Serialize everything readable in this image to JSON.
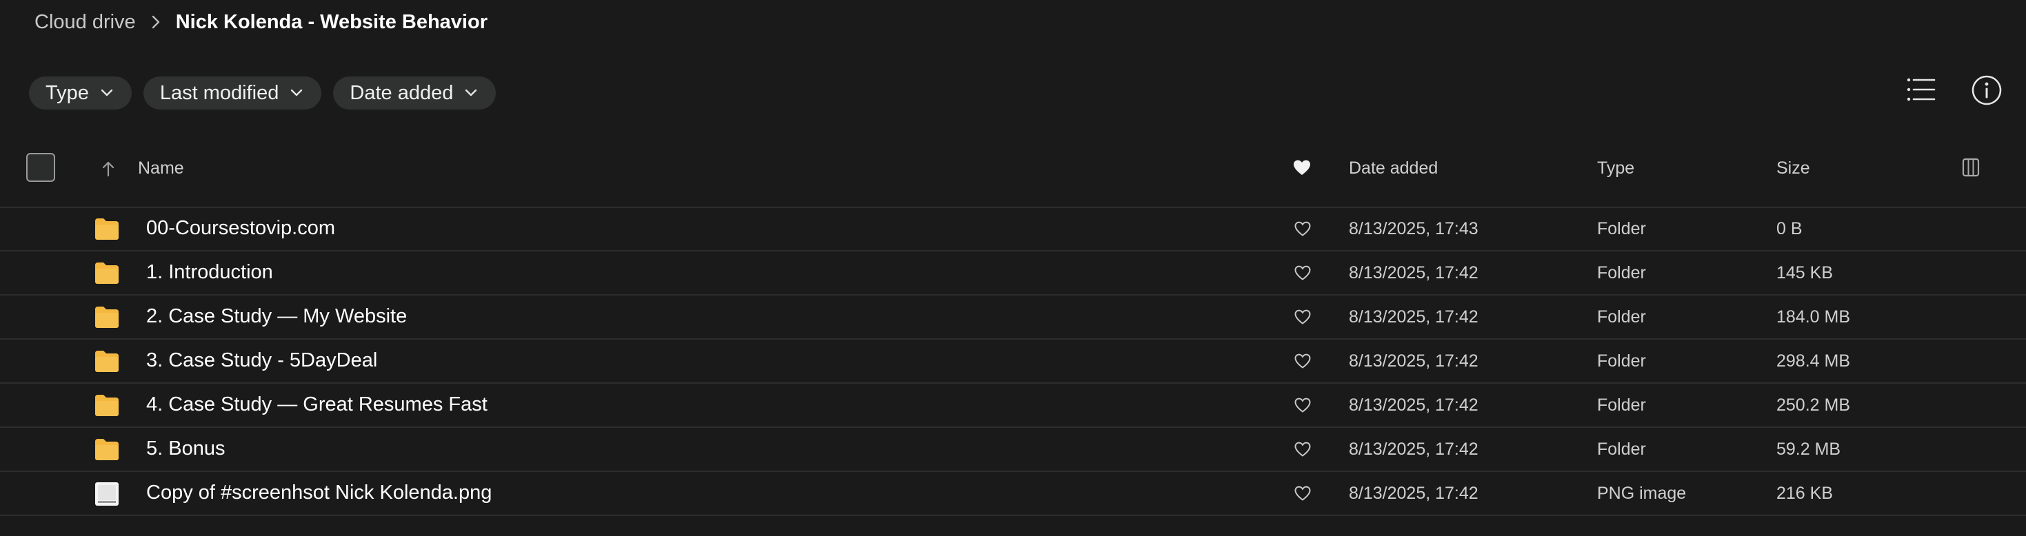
{
  "breadcrumb": {
    "root": "Cloud drive",
    "current": "Nick Kolenda - Website Behavior"
  },
  "filters": [
    {
      "label": "Type"
    },
    {
      "label": "Last modified"
    },
    {
      "label": "Date added"
    }
  ],
  "table": {
    "headers": {
      "name": "Name",
      "date_added": "Date added",
      "type": "Type",
      "size": "Size"
    },
    "rows": [
      {
        "name": "00-Coursestovip.com",
        "date": "8/13/2025, 17:43",
        "type": "Folder",
        "size": "0 B",
        "icon": "folder-icon"
      },
      {
        "name": "1. Introduction",
        "date": "8/13/2025, 17:42",
        "type": "Folder",
        "size": "145 KB",
        "icon": "folder-icon"
      },
      {
        "name": "2. Case Study — My Website",
        "date": "8/13/2025, 17:42",
        "type": "Folder",
        "size": "184.0 MB",
        "icon": "folder-icon"
      },
      {
        "name": "3. Case Study - 5DayDeal",
        "date": "8/13/2025, 17:42",
        "type": "Folder",
        "size": "298.4 MB",
        "icon": "folder-icon"
      },
      {
        "name": "4. Case Study — Great Resumes Fast",
        "date": "8/13/2025, 17:42",
        "type": "Folder",
        "size": "250.2 MB",
        "icon": "folder-icon"
      },
      {
        "name": "5. Bonus",
        "date": "8/13/2025, 17:42",
        "type": "Folder",
        "size": "59.2 MB",
        "icon": "folder-icon"
      },
      {
        "name": "Copy of #screenhsot Nick Kolenda.png",
        "date": "8/13/2025, 17:42",
        "type": "PNG image",
        "size": "216 KB",
        "icon": "image-file-icon"
      }
    ]
  },
  "colors": {
    "background": "#191a19",
    "chip": "#303131",
    "folder": "#f4b73f",
    "divider": "#2c2d2d"
  }
}
